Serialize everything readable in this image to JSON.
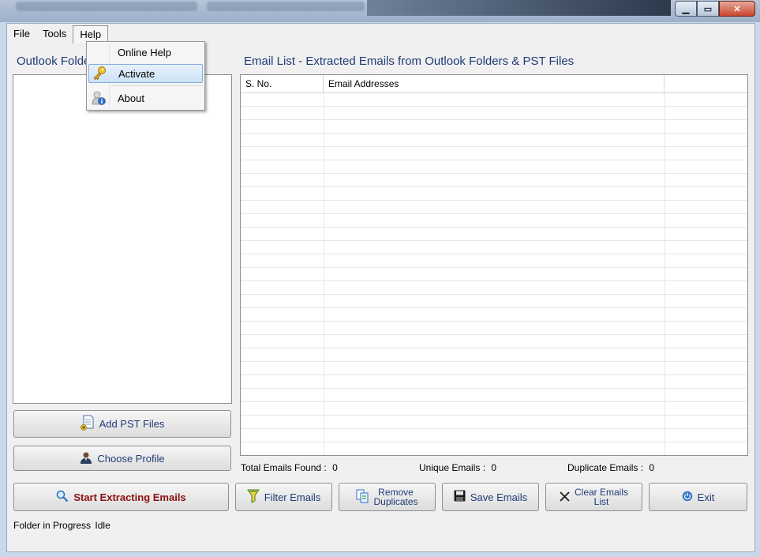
{
  "window": {
    "minimize_glyph": "▁",
    "maximize_glyph": "▭",
    "close_glyph": "✕"
  },
  "menu": {
    "file": "File",
    "tools": "Tools",
    "help": "Help"
  },
  "help_menu": {
    "items": [
      {
        "label": "Online Help",
        "icon": ""
      },
      {
        "label": "Activate",
        "icon": "key-icon"
      },
      {
        "label": "About",
        "icon": "about-info-icon"
      }
    ]
  },
  "left_panel": {
    "title": "Outlook Folders"
  },
  "buttons": {
    "add_pst": "Add PST Files",
    "choose_profile": "Choose Profile",
    "start": "Start Extracting Emails",
    "filter": "Filter Emails",
    "remove_dup_line1": "Remove",
    "remove_dup_line2": "Duplicates",
    "save": "Save Emails",
    "clear_line1": "Clear Emails",
    "clear_line2": "List",
    "exit": "Exit"
  },
  "email_list": {
    "title": "Email List - Extracted Emails from Outlook Folders & PST Files",
    "columns": [
      "S. No.",
      "Email Addresses",
      ""
    ]
  },
  "stats": {
    "total_label": "Total Emails Found :",
    "total_value": "0",
    "unique_label": "Unique Emails :",
    "unique_value": "0",
    "duplicate_label": "Duplicate Emails :",
    "duplicate_value": "0"
  },
  "status": {
    "label": "Folder in Progress",
    "value": "Idle"
  },
  "colors": {
    "accent_text": "#1f3b78",
    "start_text": "#8b1010",
    "menu_highlight": "#cde3f8"
  }
}
